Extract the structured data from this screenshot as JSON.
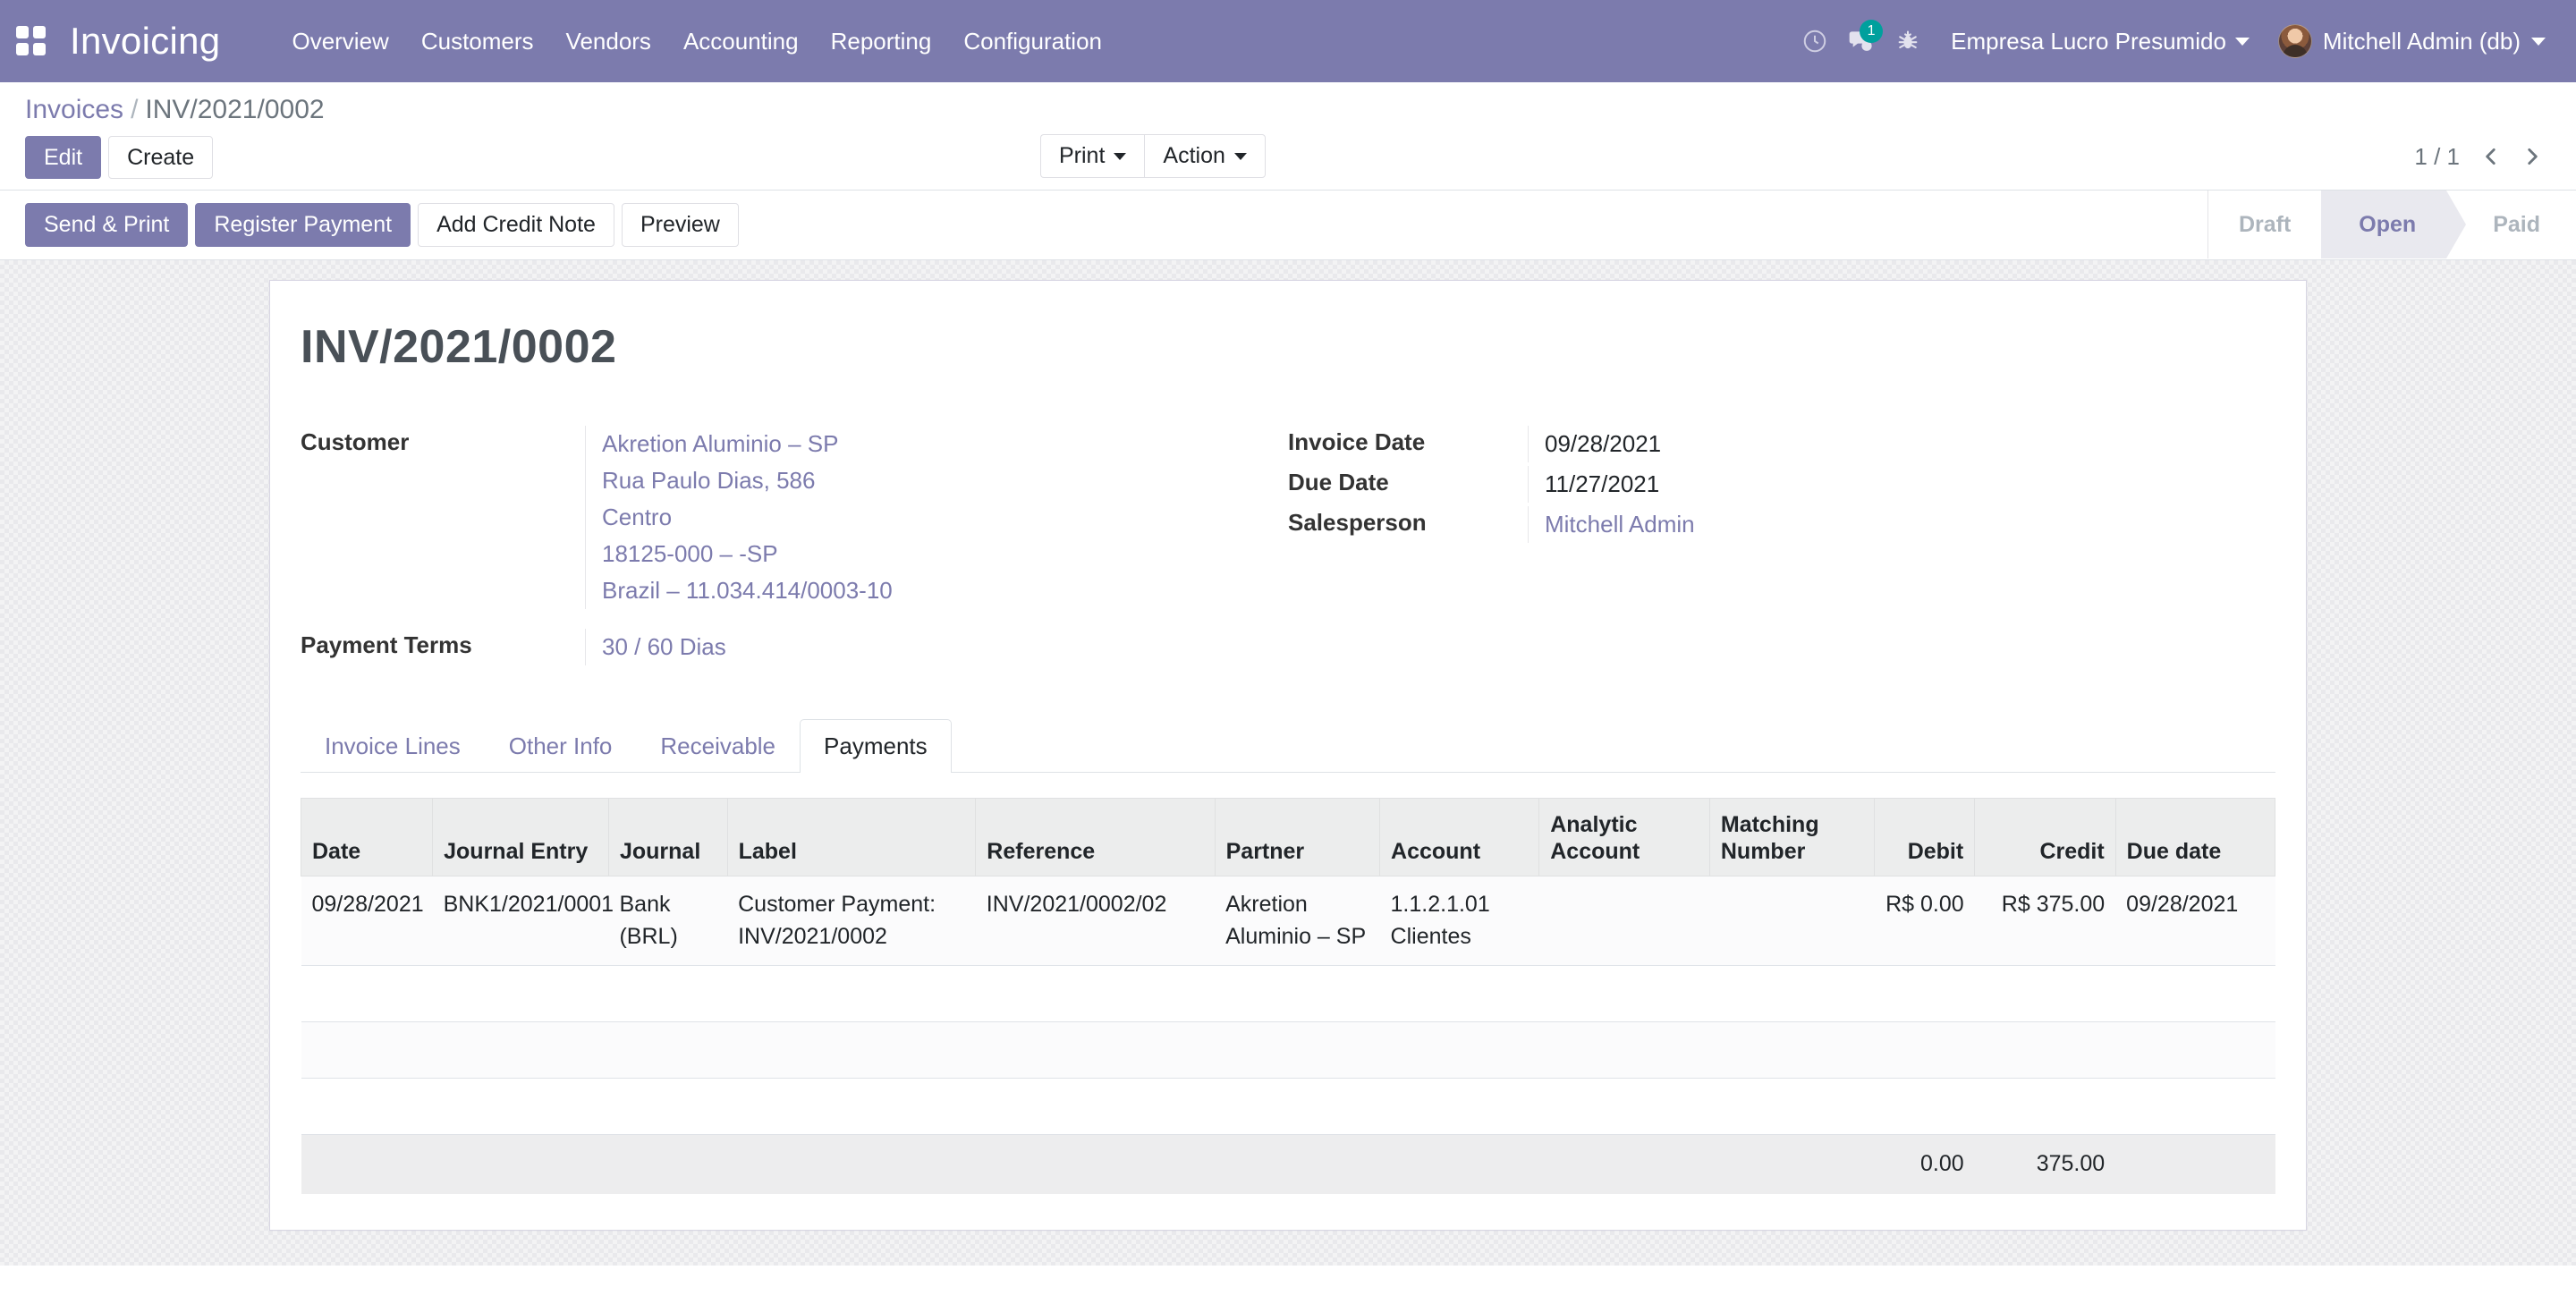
{
  "navbar": {
    "apps_icon": "apps-grid-icon",
    "brand": "Invoicing",
    "menu": [
      {
        "label": "Overview"
      },
      {
        "label": "Customers"
      },
      {
        "label": "Vendors"
      },
      {
        "label": "Accounting"
      },
      {
        "label": "Reporting"
      },
      {
        "label": "Configuration"
      }
    ],
    "icons": {
      "activity": "clock-icon",
      "messaging": "chat-bubble-icon",
      "messaging_count": "1",
      "debug": "bug-icon"
    },
    "company": "Empresa Lucro Presumido",
    "user": "Mitchell Admin (db)",
    "brand_color": "#7c7bad",
    "badge_color": "#00a09d"
  },
  "control_panel": {
    "breadcrumb_root": "Invoices",
    "breadcrumb_sep": "/",
    "breadcrumb_current": "INV/2021/0002",
    "edit_label": "Edit",
    "create_label": "Create",
    "print_label": "Print",
    "action_label": "Action",
    "pager_value": "1 / 1"
  },
  "statusbar": {
    "buttons": [
      {
        "label": "Send & Print",
        "style": "primary"
      },
      {
        "label": "Register Payment",
        "style": "primary"
      },
      {
        "label": "Add Credit Note",
        "style": "default"
      },
      {
        "label": "Preview",
        "style": "default"
      }
    ],
    "stages": [
      {
        "label": "Draft",
        "active": false
      },
      {
        "label": "Open",
        "active": true
      },
      {
        "label": "Paid",
        "active": false
      }
    ]
  },
  "sheet": {
    "title": "INV/2021/0002",
    "left_fields": [
      {
        "label": "Customer",
        "link": true,
        "lines": [
          "Akretion Aluminio – SP",
          "Rua Paulo Dias, 586",
          "Centro",
          "18125-000 – -SP",
          "Brazil – 11.034.414/0003-10"
        ]
      },
      {
        "label": "Payment Terms",
        "link": true,
        "lines": [
          "30 / 60 Dias"
        ]
      }
    ],
    "right_fields": [
      {
        "label": "Invoice Date",
        "link": false,
        "lines": [
          "09/28/2021"
        ]
      },
      {
        "label": "Due Date",
        "link": false,
        "lines": [
          "11/27/2021"
        ]
      },
      {
        "label": "Salesperson",
        "link": true,
        "lines": [
          "Mitchell Admin"
        ]
      }
    ],
    "tabs": [
      {
        "label": "Invoice Lines",
        "active": false
      },
      {
        "label": "Other Info",
        "active": false
      },
      {
        "label": "Receivable",
        "active": false
      },
      {
        "label": "Payments",
        "active": true
      }
    ],
    "payments_table": {
      "headers": [
        "Date",
        "Journal Entry",
        "Journal",
        "Label",
        "Reference",
        "Partner",
        "Account",
        "Analytic Account",
        "Matching Number",
        "Debit",
        "Credit",
        "Due date"
      ],
      "rows": [
        {
          "date": "09/28/2021",
          "journal_entry": "BNK1/2021/0001",
          "journal": "Bank (BRL)",
          "label": "Customer Payment: INV/2021/0002",
          "reference": "INV/2021/0002/02",
          "partner": "Akretion Aluminio – SP",
          "account": "1.1.2.1.01 Clientes",
          "analytic_account": "",
          "matching_number": "",
          "debit": "R$ 0.00",
          "credit": "R$ 375.00",
          "due_date": "09/28/2021"
        }
      ],
      "empty_row_count": 2,
      "totals": {
        "debit": "0.00",
        "credit": "375.00"
      }
    }
  }
}
